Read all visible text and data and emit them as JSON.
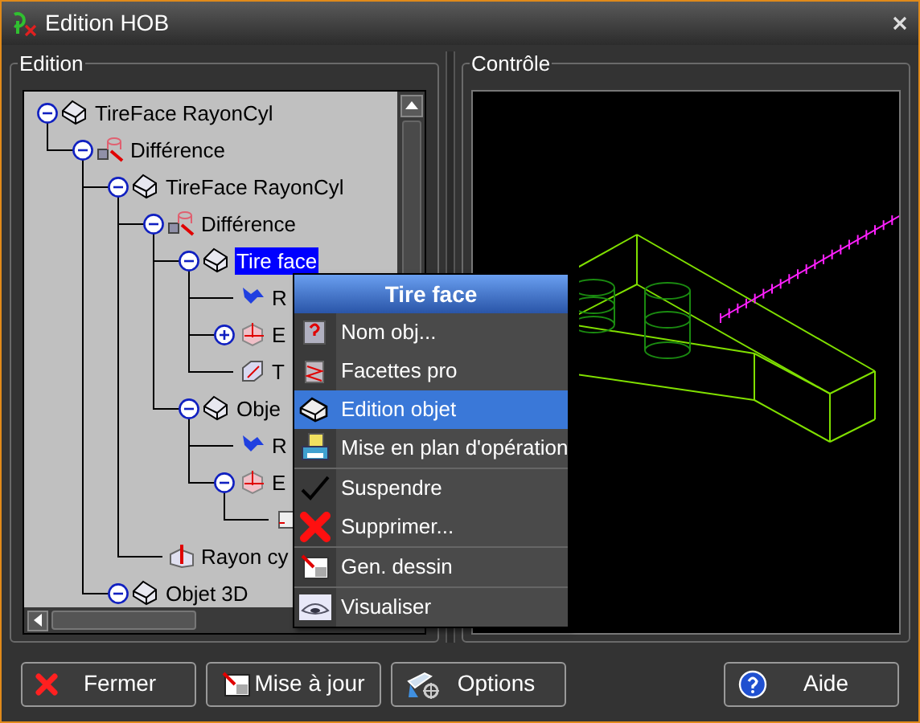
{
  "window": {
    "title": "Edition HOB"
  },
  "edition_panel": {
    "title": "Edition",
    "tree": [
      {
        "label": "TireFace RayonCyl",
        "kind": "face",
        "expanded": true,
        "selected": false,
        "children": [
          {
            "label": "Différence",
            "kind": "difference",
            "expanded": true,
            "selected": false,
            "children": [
              {
                "label": "TireFace RayonCyl",
                "kind": "face",
                "expanded": true,
                "selected": false,
                "children": [
                  {
                    "label": "Différence",
                    "kind": "difference",
                    "expanded": true,
                    "selected": false,
                    "children": [
                      {
                        "label": "Tire face",
                        "kind": "face",
                        "expanded": true,
                        "selected": true,
                        "children": [
                          {
                            "label": "R",
                            "kind": "reference",
                            "selected": false
                          },
                          {
                            "label": "E",
                            "kind": "body",
                            "expanded": false,
                            "selected": false
                          },
                          {
                            "label": "T",
                            "kind": "tool",
                            "selected": false
                          }
                        ]
                      },
                      {
                        "label": "Obje",
                        "kind": "face",
                        "expanded": true,
                        "selected": false,
                        "children": [
                          {
                            "label": "R",
                            "kind": "reference",
                            "selected": false
                          },
                          {
                            "label": "E",
                            "kind": "body",
                            "expanded": true,
                            "selected": false,
                            "children": [
                              {
                                "kind": "sketch"
                              }
                            ]
                          }
                        ]
                      }
                    ]
                  },
                  {
                    "label": "Rayon cy",
                    "kind": "radius",
                    "selected": false
                  }
                ]
              },
              {
                "label": "Objet 3D",
                "kind": "face",
                "expanded": true,
                "selected": false
              }
            ]
          }
        ]
      }
    ]
  },
  "control_panel": {
    "title": "Contrôle"
  },
  "context_menu": {
    "title": "Tire face",
    "groups": [
      [
        {
          "label": "Nom obj...",
          "kind": "name",
          "selected": false
        },
        {
          "label": "Facettes pro",
          "kind": "facets",
          "selected": false
        },
        {
          "label": "Edition objet",
          "kind": "face",
          "selected": true
        },
        {
          "label": "Mise en plan d'opération",
          "kind": "plan",
          "selected": false
        }
      ],
      [
        {
          "label": "Suspendre",
          "kind": "check",
          "selected": false
        },
        {
          "label": "Supprimer...",
          "kind": "delete",
          "selected": false
        }
      ],
      [
        {
          "label": "Gen. dessin",
          "kind": "drawing",
          "selected": false
        }
      ],
      [
        {
          "label": "Visualiser",
          "kind": "view",
          "selected": false
        }
      ]
    ]
  },
  "buttons": [
    {
      "label": "Fermer",
      "kind": "close"
    },
    {
      "label": "Mise à jour",
      "kind": "update"
    },
    {
      "label": "Options",
      "kind": "options"
    },
    {
      "label": "Aide",
      "kind": "help"
    }
  ]
}
